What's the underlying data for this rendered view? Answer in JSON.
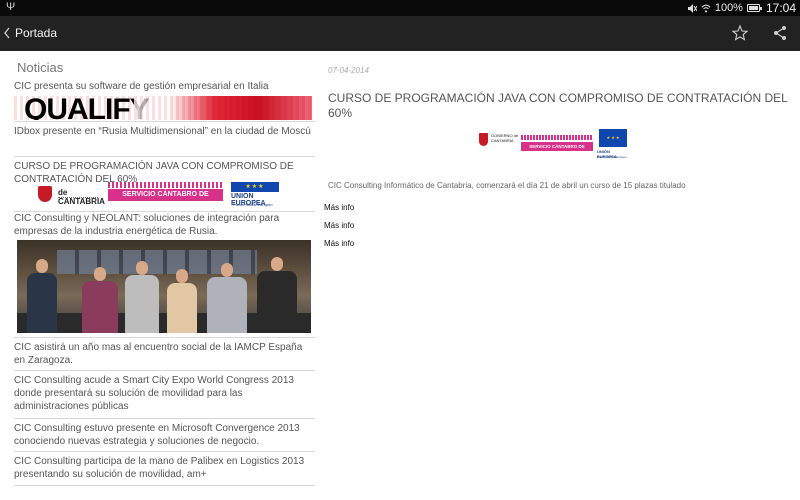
{
  "status_bar": {
    "battery_percent": "100%",
    "time": "17:04"
  },
  "action_bar": {
    "title": "Portada"
  },
  "list": {
    "section_title": "Noticias",
    "items": [
      {
        "title": "CIC presenta su software de gestión empresarial en Italia",
        "thumb_text": "QUALIFY"
      },
      {
        "title": "IDbox presente en  “Rusia Multidimensional” en la ciudad de Moscú"
      },
      {
        "title": "CURSO DE PROGRAMACIÓN JAVA CON COMPROMISO DE CONTRATACIÓN DEL 60%",
        "logo_texts": [
          "de CANTABRIA",
          "SERVICIO CÁNTABRO DE EMPLEO",
          "UNIÓN EUROPEA",
          "Fondo Social Europeo"
        ]
      },
      {
        "title": "CIC Consulting y NEOLANT: soluciones de integración para empresas de la industria energética de Rusia."
      },
      {
        "title": "CIC asistirá un año mas al encuentro social de la IAMCP España en Zaragoza."
      },
      {
        "title": "CIC Consulting acude a Smart City Expo World Congress 2013 donde presentará su solución de movilidad para las administraciones públicas"
      },
      {
        "title": "CIC Consulting estuvo presente en Microsoft Convergence 2013 conociendo nuevas estrategia y soluciones de negocio."
      },
      {
        "title": "CIC Consulting participa de la mano de Palibex en Logistics 2013 presentando su solución de movilidad, am+"
      }
    ]
  },
  "detail": {
    "date": "07-04-2014",
    "headline": "CURSO DE PROGRAMACIÓN JAVA CON COMPROMISO DE CONTRATACIÓN DEL 60%",
    "logos": {
      "gob_text": "GOBIERNO de CANTABRIA",
      "empleo_text": "SERVICIO CÁNTABRO DE EMPLEO",
      "ue_text": "UNIÓN EUROPEA",
      "ue_sub": "Fondo Social Europeo"
    },
    "body": "CIC Consulting Informático de Cantabria, comenzará el día 21 de abril un curso de 15 plazas titulado",
    "more_links": [
      "Más info",
      "Más info",
      "Más info"
    ]
  },
  "icons": {
    "back": "chevron-left-icon",
    "favorite": "star-icon",
    "share": "share-icon",
    "usb": "usb-icon",
    "mute": "mute-icon",
    "wifi": "wifi-icon",
    "battery": "battery-icon"
  },
  "colors": {
    "status_bar": "#0a0a0a",
    "action_bar": "#222222",
    "empleo_magenta": "#d7318a",
    "eu_blue": "#0f47af"
  }
}
